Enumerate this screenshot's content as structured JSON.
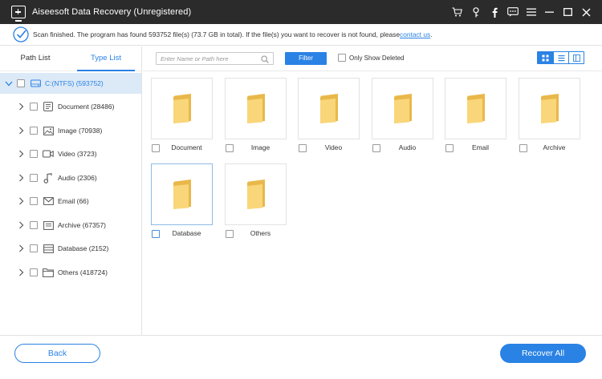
{
  "app": {
    "title": "Aiseesoft Data Recovery (Unregistered)"
  },
  "colors": {
    "accent": "#2a82e4",
    "titlebar": "#2b2b2b",
    "folder": "#f9d67a",
    "selected_row": "#dce9f7"
  },
  "title_icons": [
    "cart-icon",
    "key-icon",
    "facebook-icon",
    "feedback-icon",
    "menu-icon",
    "minimize-icon",
    "maximize-icon",
    "close-icon"
  ],
  "status": {
    "message": "Scan finished. The program has found 593752 file(s) (73.7 GB in total). If the file(s) you want to recover is not found, please ",
    "link": "contact us",
    "suffix": "."
  },
  "sidebar": {
    "tabs": [
      {
        "label": "Path List",
        "active": false
      },
      {
        "label": "Type List",
        "active": true
      }
    ],
    "root": {
      "label": "C:(NTFS) (593752)"
    },
    "items": [
      {
        "label": "Document (28486)",
        "icon": "document-icon"
      },
      {
        "label": "Image (70938)",
        "icon": "image-icon"
      },
      {
        "label": "Video (3723)",
        "icon": "video-icon"
      },
      {
        "label": "Audio (2306)",
        "icon": "audio-icon"
      },
      {
        "label": "Email (66)",
        "icon": "email-icon"
      },
      {
        "label": "Archive (67357)",
        "icon": "archive-icon"
      },
      {
        "label": "Database (2152)",
        "icon": "database-icon"
      },
      {
        "label": "Others (418724)",
        "icon": "others-icon"
      }
    ]
  },
  "toolbar": {
    "search_placeholder": "Enter Name or Path here",
    "filter_label": "Filter",
    "only_show_deleted": "Only Show Deleted",
    "views": [
      "grid-view-icon",
      "list-view-icon",
      "detail-view-icon"
    ]
  },
  "folders": [
    {
      "label": "Document"
    },
    {
      "label": "Image"
    },
    {
      "label": "Video"
    },
    {
      "label": "Audio"
    },
    {
      "label": "Email"
    },
    {
      "label": "Archive"
    },
    {
      "label": "Database",
      "selected": true
    },
    {
      "label": "Others"
    }
  ],
  "footer": {
    "back_label": "Back",
    "recover_label": "Recover All"
  }
}
